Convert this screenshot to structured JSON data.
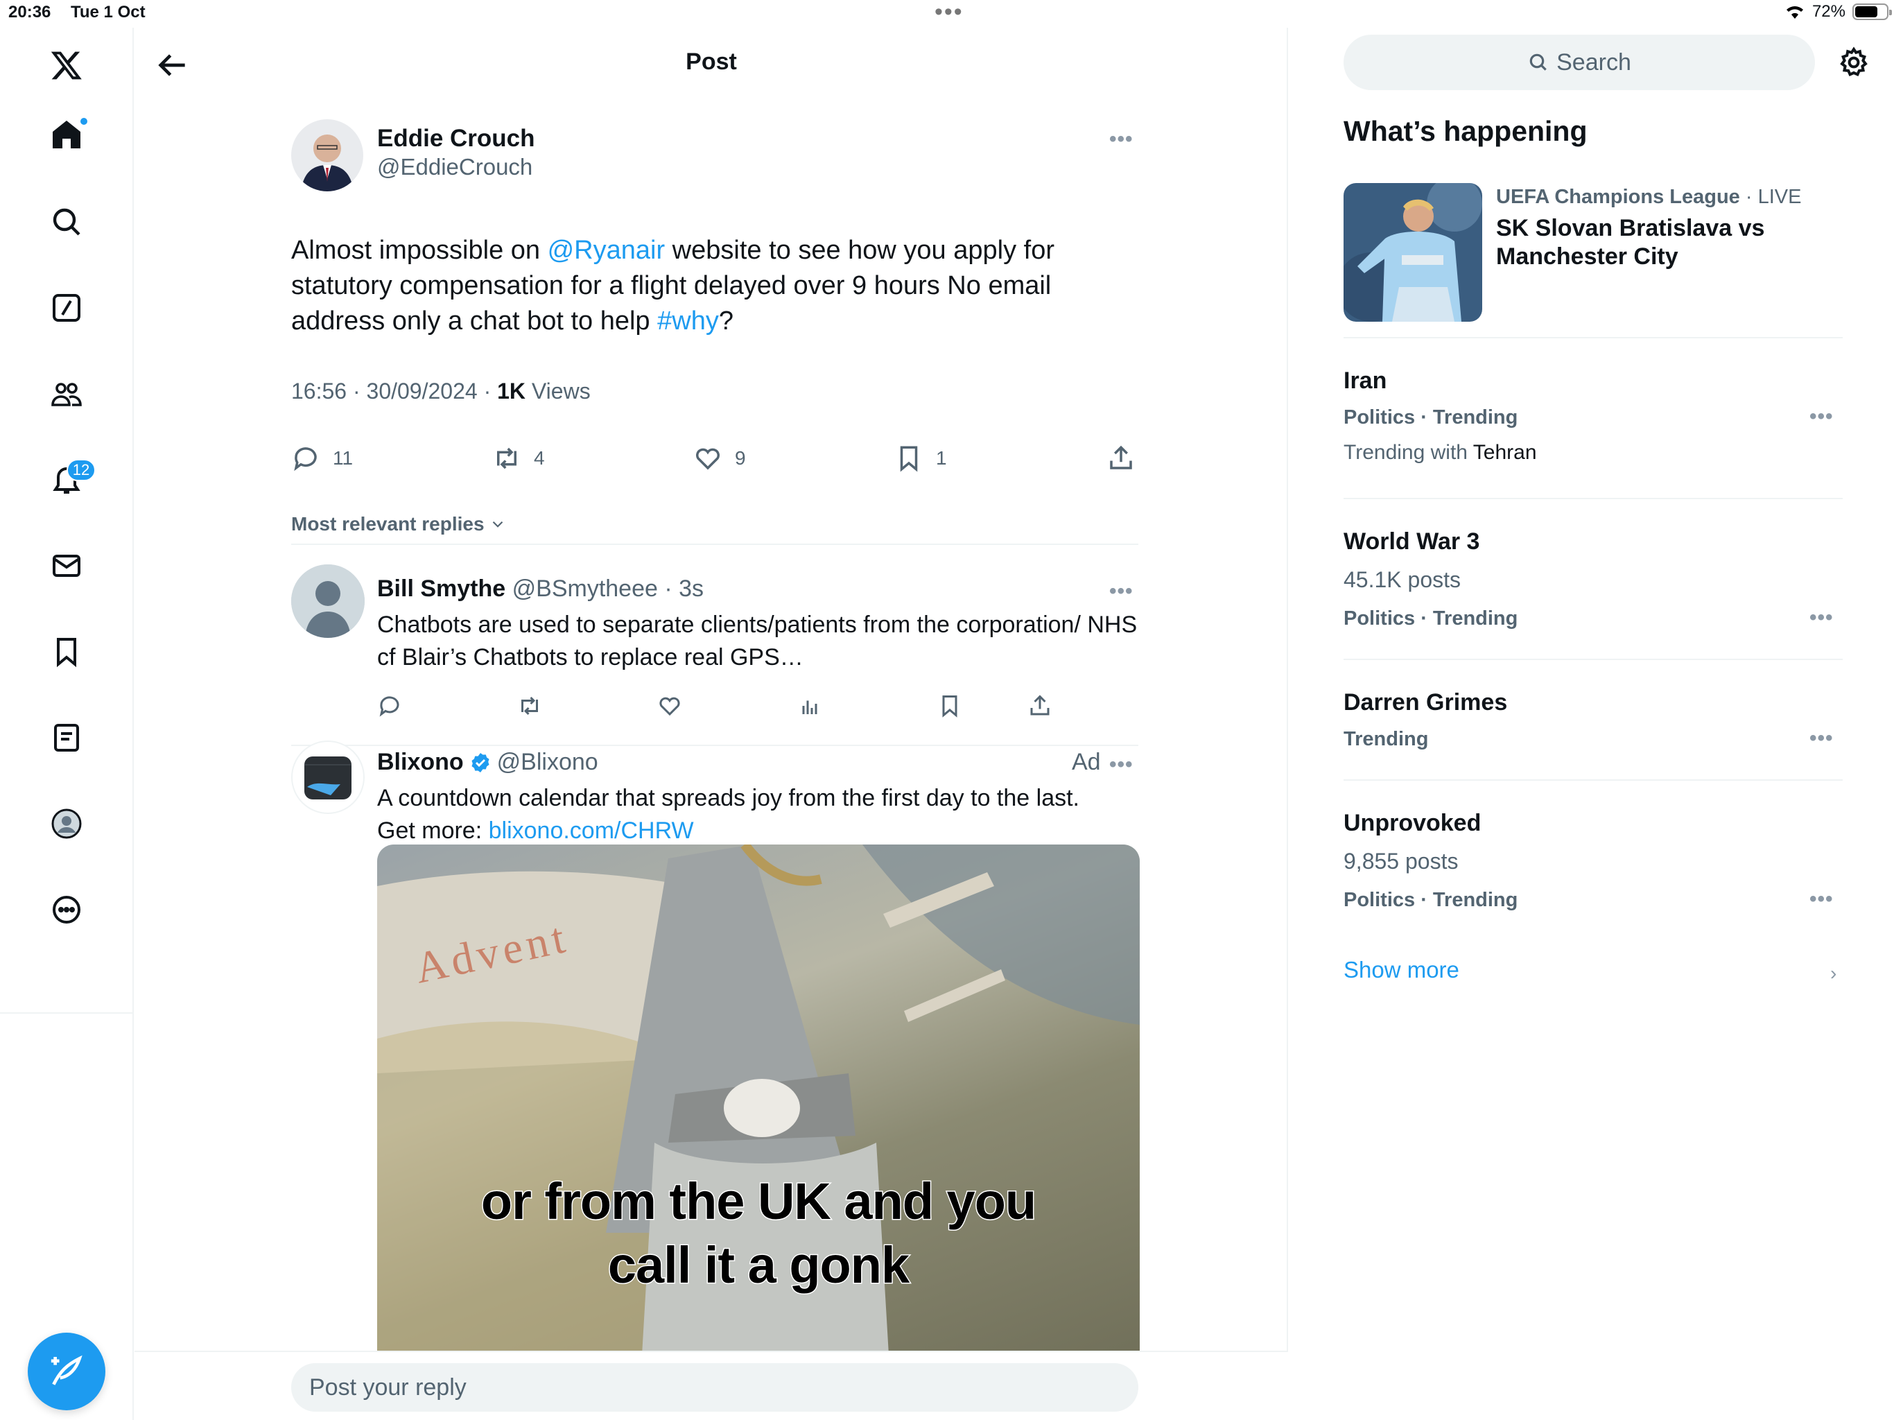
{
  "status_bar": {
    "time": "20:36",
    "date": "Tue 1 Oct",
    "battery": "72%",
    "battery_level": 0.72
  },
  "nav": {
    "notifications_count": "12"
  },
  "header": {
    "title": "Post"
  },
  "tweet": {
    "author_name": "Eddie Crouch",
    "author_handle": "@EddieCrouch",
    "text_before_mention": "Almost impossible on ",
    "mention": "@Ryanair",
    "text_after_mention": " website to see how you apply for statutory compensation for a flight delayed over 9 hours No email address only a chat bot to help ",
    "hashtag": "#why",
    "text_end": "?",
    "timestamp": "16:56 · 30/09/2024 · ",
    "views_count": "1K",
    "views_label": " Views",
    "replies": "11",
    "reposts": "4",
    "likes": "9",
    "bookmarks": "1"
  },
  "replies_sort": "Most relevant replies",
  "reply": {
    "name": "Bill Smythe",
    "handle": "@BSmytheee",
    "time": " · 3s",
    "text": "Chatbots are used to separate clients/patients from the corporation/ NHS cf Blair’s Chatbots to replace real GPS…"
  },
  "ad": {
    "name": "Blixono",
    "handle": "@Blixono",
    "label": "Ad",
    "text": "A countdown calendar that spreads joy from the first day to the last.",
    "get_more": "Get more: ",
    "link": "blixono.com/CHRW",
    "media_caption_line1": "or from the UK and you",
    "media_caption_line2": "call it a gonk",
    "media_bg_text": "Advent"
  },
  "reply_box": {
    "placeholder": "Post your reply"
  },
  "sidebar": {
    "search_placeholder": "Search",
    "section_title": "What’s happening",
    "featured": {
      "context": "UEFA Champions League",
      "live": " · LIVE",
      "title_line1": "SK Slovan Bratislava vs",
      "title_line2": "Manchester City"
    },
    "trends": [
      {
        "title": "Iran",
        "context": "Politics · Trending",
        "sub_prefix": "Trending with ",
        "sub_value": "Tehran"
      },
      {
        "title": "World War 3",
        "posts": "45.1K posts",
        "context": "Politics · Trending"
      },
      {
        "title": "Darren Grimes",
        "context": "Trending"
      },
      {
        "title": "Unprovoked",
        "posts": "9,855 posts",
        "context": "Politics · Trending"
      }
    ],
    "show_more": "Show more"
  },
  "colors": {
    "accent": "#1d9bf0",
    "muted": "#536471",
    "text": "#0f1419",
    "divider": "#eff3f4"
  }
}
